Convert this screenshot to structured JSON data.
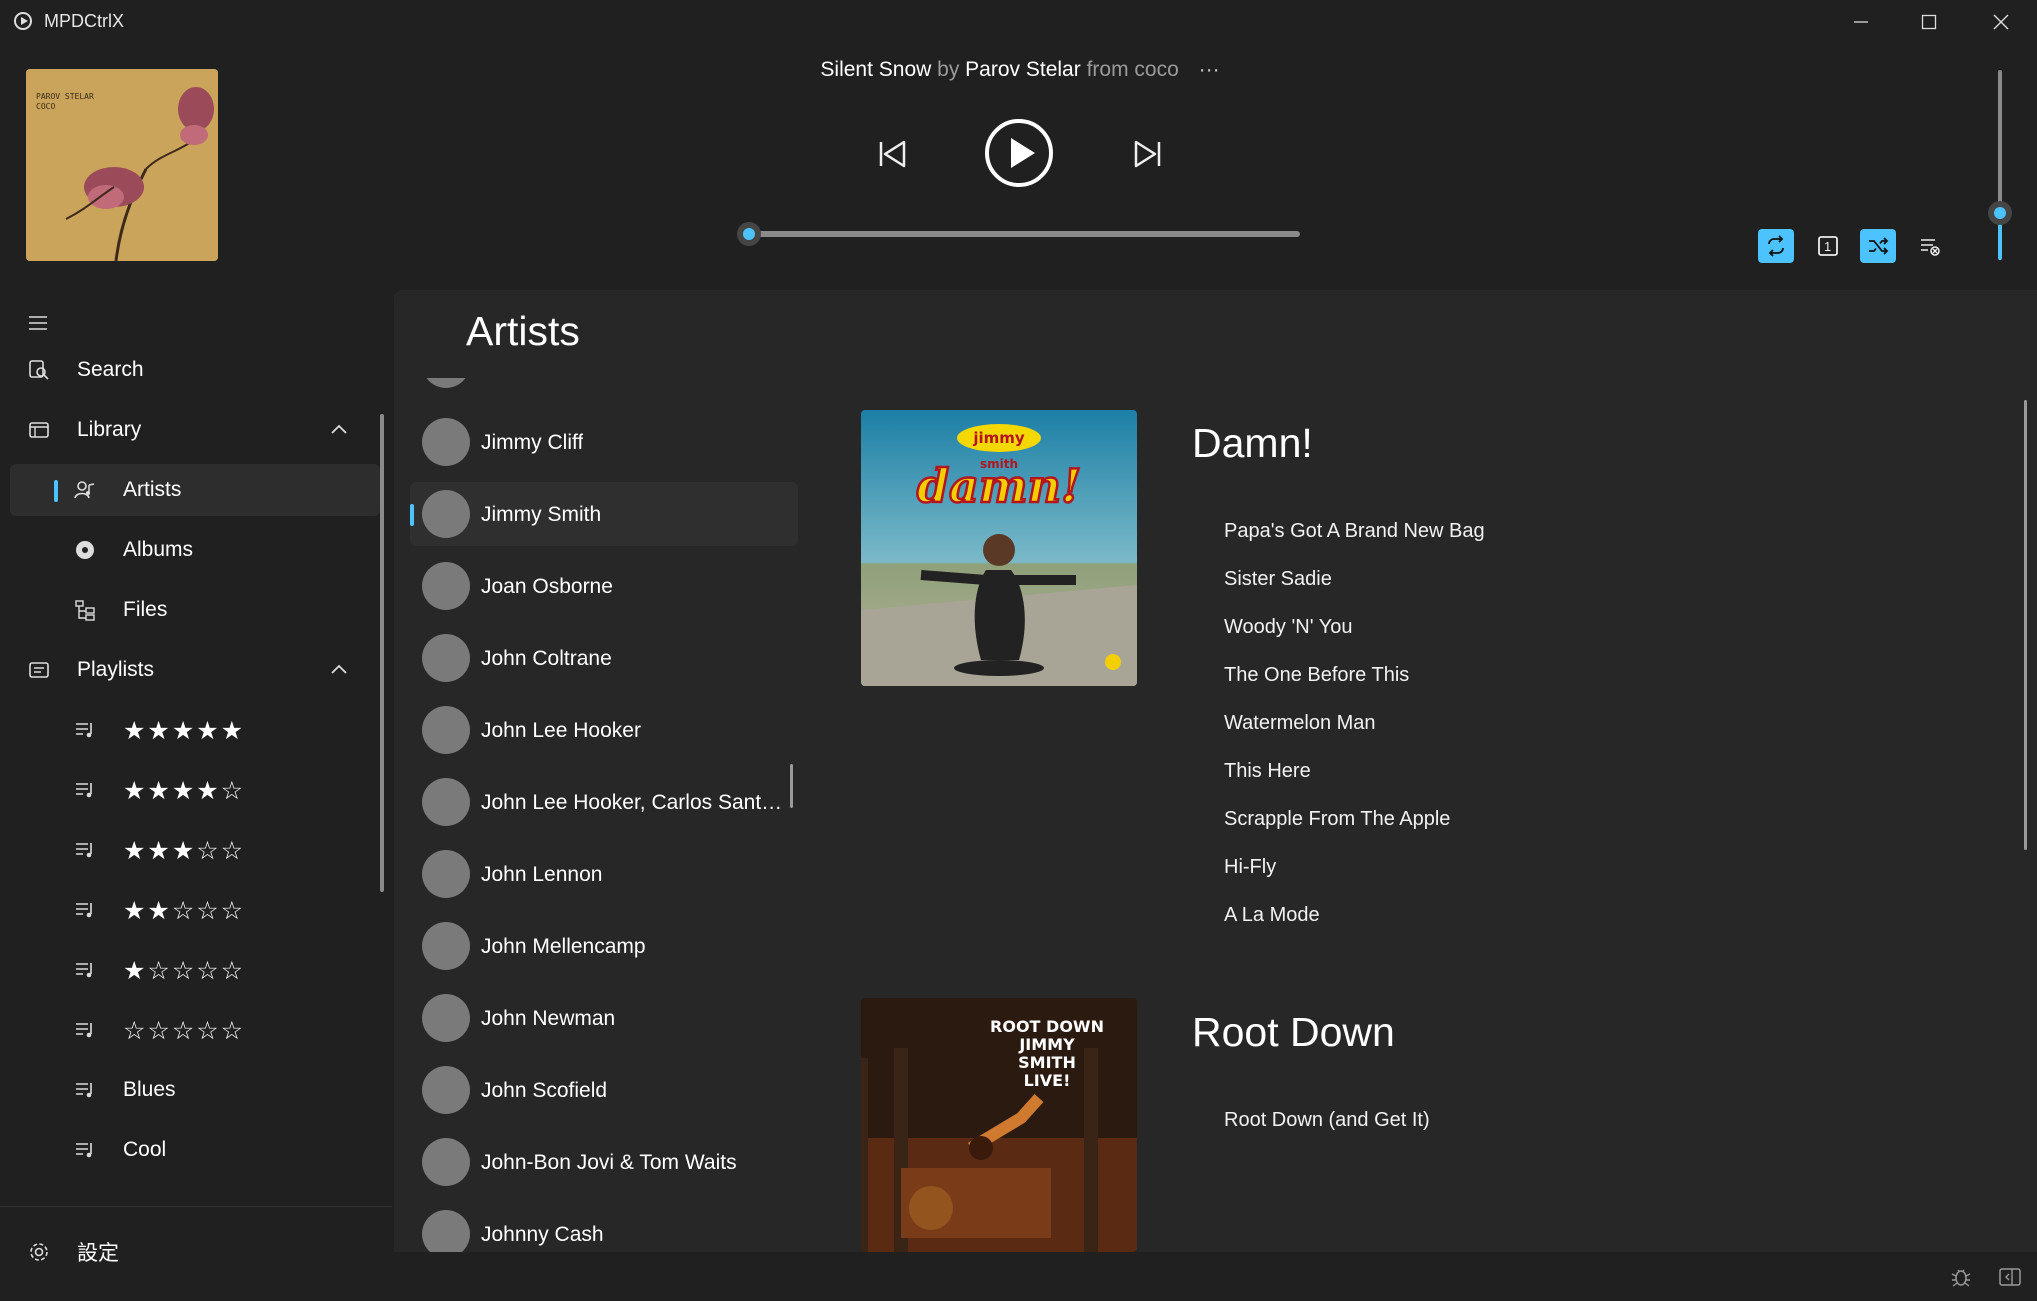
{
  "app": {
    "title": "MPDCtrlX"
  },
  "player": {
    "song": "Silent Snow",
    "by_label": "by",
    "artist": "Parov Stelar",
    "from_label": "from",
    "album": "coco",
    "more_label": "···",
    "seek_position": 0.0,
    "volume_level": 0.3,
    "album_art_text": [
      "PAROV STELAR",
      "COCO"
    ],
    "toggles": [
      {
        "name": "repeat",
        "active": true
      },
      {
        "name": "single",
        "active": false,
        "label": "1"
      },
      {
        "name": "shuffle",
        "active": true
      },
      {
        "name": "consume",
        "active": false
      }
    ]
  },
  "nav": {
    "search": "Search",
    "library": "Library",
    "artists": "Artists",
    "albums": "Albums",
    "files": "Files",
    "playlists": "Playlists",
    "playlist_items": [
      "★★★★★",
      "★★★★☆",
      "★★★☆☆",
      "★★☆☆☆",
      "★☆☆☆☆",
      "☆☆☆☆☆",
      "Blues",
      "Cool"
    ],
    "settings": "設定"
  },
  "main": {
    "page_title": "Artists",
    "artists": [
      "Jimmy Cliff",
      "Jimmy Smith",
      "Joan Osborne",
      "John Coltrane",
      "John Lee Hooker",
      "John Lee Hooker, Carlos Santana",
      "John Lennon",
      "John Mellencamp",
      "John Newman",
      "John Scofield",
      "John-Bon Jovi & Tom Waits",
      "Johnny Cash"
    ],
    "selected_artist": "Jimmy Smith",
    "albums": [
      {
        "title": "Damn!",
        "cover_text": [
          "jimmy",
          "smith",
          "damn!"
        ],
        "tracks": [
          "Papa's Got A Brand New Bag",
          "Sister Sadie",
          "Woody 'N' You",
          "The One Before This",
          "Watermelon Man",
          "This Here",
          "Scrapple From The Apple",
          "Hi-Fly",
          "A La Mode"
        ]
      },
      {
        "title": "Root Down",
        "cover_text": [
          "ROOT DOWN",
          "JIMMY",
          "SMITH",
          "LIVE!"
        ],
        "tracks": [
          "Root Down (and Get It)"
        ]
      }
    ]
  },
  "colors": {
    "accent": "#4cc2ff",
    "background": "#202020",
    "panel": "#272727"
  }
}
